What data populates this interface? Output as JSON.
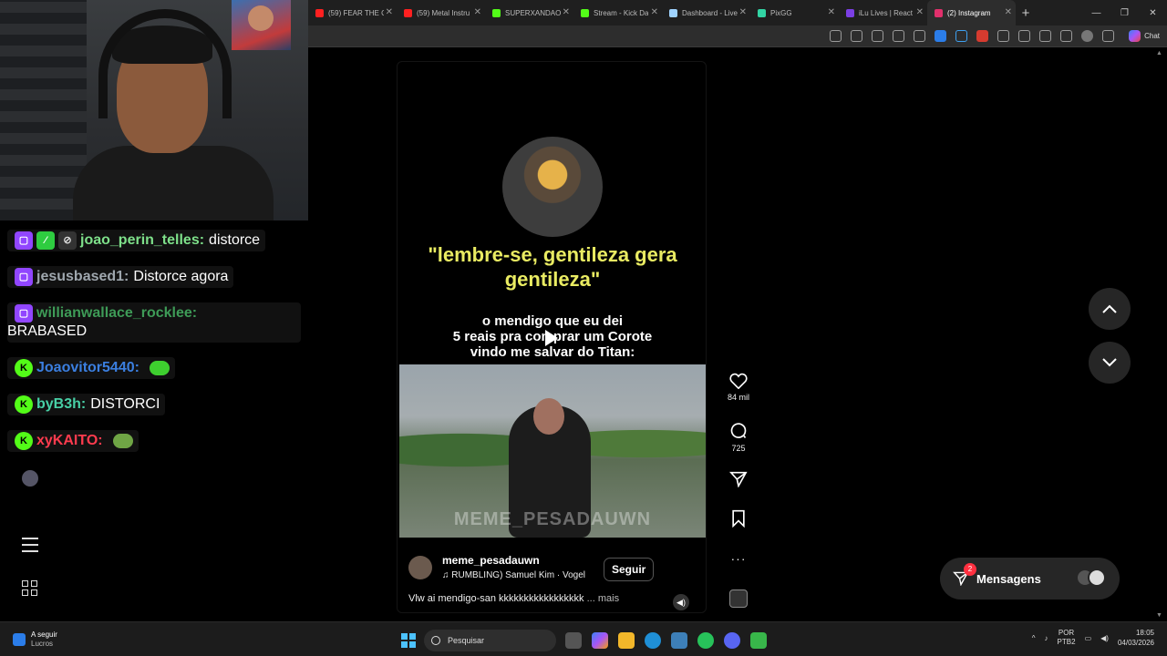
{
  "browser": {
    "tabs": [
      {
        "label": "(59) FEAR THE CI",
        "color": "#ff2020"
      },
      {
        "label": "(59) Metal Instru",
        "color": "#ff2020"
      },
      {
        "label": "SUPERXANDAO",
        "color": "#53fc18"
      },
      {
        "label": "Stream - Kick Da",
        "color": "#53fc18"
      },
      {
        "label": "Dashboard - Live",
        "color": "#9fd3ff"
      },
      {
        "label": "PixGG",
        "color": "#32d4a4"
      },
      {
        "label": "iLu Lives | React",
        "color": "#7b3fe4"
      },
      {
        "label": "(2) Instagram",
        "color": "#e1306c",
        "active": true
      }
    ],
    "copilot_label": "Chat"
  },
  "chat": [
    {
      "user": "joao_perin_telles:",
      "message": "distorce",
      "user_color": "#7ee08a",
      "badges": [
        "twitch",
        "green",
        "mod"
      ]
    },
    {
      "user": "jesusbased1:",
      "message": "Distorce agora",
      "user_color": "#9fa7ae",
      "badges": [
        "twitch"
      ]
    },
    {
      "user": "willianwallace_rocklee:",
      "message": "BRABASED",
      "user_color": "#3e9b57",
      "badges": [
        "twitch"
      ],
      "wrap": true
    },
    {
      "user": "Joaovitor5440:",
      "message": "",
      "user_color": "#3b7fe0",
      "badges": [
        "kick"
      ],
      "emote": "#3ecf2f"
    },
    {
      "user": "byB3h:",
      "message": "DISTORCI",
      "user_color": "#48d0a6",
      "badges": [
        "kick"
      ]
    },
    {
      "user": "xyKAITO:",
      "message": "",
      "user_color": "#ff3b4e",
      "badges": [
        "kick"
      ],
      "emote": "#6fa545"
    }
  ],
  "reel": {
    "quote": "\"lembre-se, gentileza gera gentileza\"",
    "overlay_lines": [
      "o mendigo que eu dei",
      "5 reais pra comprar um Corote",
      "vindo me salvar do Titan:"
    ],
    "watermark": "MEME_PESADAUWN",
    "username": "meme_pesadauwn",
    "music": "RUMBLING)  Samuel Kim · Vogel",
    "follow_label": "Seguir",
    "description": "Vlw ai mendigo-san kkkkkkkkkkkkkkkkk",
    "more_label": "... mais"
  },
  "actions": {
    "likes": "84 mil",
    "comments": "725"
  },
  "messages": {
    "label": "Mensagens",
    "unread": "2"
  },
  "taskbar": {
    "weather_title": "A seguir",
    "weather_sub": "Lucros",
    "search_placeholder": "Pesquisar",
    "lang": "POR",
    "layout": "PTB2",
    "time": "18:05",
    "date": "04/03/2026"
  }
}
